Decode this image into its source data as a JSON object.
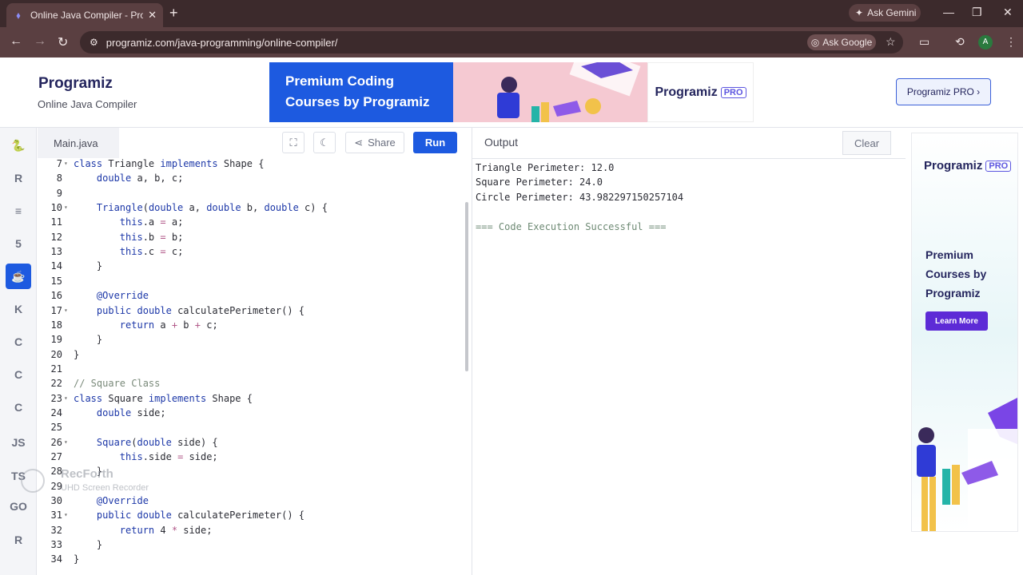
{
  "browser": {
    "tab_title": "Online Java Compiler - Program",
    "tab_close": "✕",
    "new_tab": "+",
    "ask_gemini": "Ask Gemini",
    "url": "programiz.com/java-programming/online-compiler/",
    "ask_google": "Ask Google",
    "avatar": "A"
  },
  "site": {
    "logo": "Programiz",
    "subtitle": "Online Java Compiler",
    "banner_text": "Premium Coding Courses by Programiz",
    "banner_logo": "Programiz",
    "pro_badge": "PRO",
    "pro_button": "Programiz PRO ›"
  },
  "rail": {
    "items": [
      {
        "name": "python",
        "glyph": "🐍",
        "active": false
      },
      {
        "name": "r",
        "glyph": "R",
        "active": false
      },
      {
        "name": "sql",
        "glyph": "≡",
        "active": false
      },
      {
        "name": "html",
        "glyph": "5",
        "active": false
      },
      {
        "name": "java",
        "glyph": "☕",
        "active": true
      },
      {
        "name": "kotlin",
        "glyph": "K",
        "active": false
      },
      {
        "name": "c",
        "glyph": "C",
        "active": false
      },
      {
        "name": "cpp",
        "glyph": "C",
        "active": false
      },
      {
        "name": "csharp",
        "glyph": "C",
        "active": false
      },
      {
        "name": "javascript",
        "glyph": "JS",
        "active": false
      },
      {
        "name": "typescript",
        "glyph": "TS",
        "active": false
      },
      {
        "name": "go",
        "glyph": "GO",
        "active": false
      },
      {
        "name": "rust",
        "glyph": "R",
        "active": false
      }
    ]
  },
  "editor": {
    "file_tab": "Main.java",
    "share_label": "Share",
    "run_label": "Run",
    "lines": [
      {
        "n": "7",
        "fold": true,
        "tokens": [
          [
            "kw",
            "class"
          ],
          [
            "ct",
            " Triangle "
          ],
          [
            "kw",
            "implements"
          ],
          [
            "ct",
            " Shape {"
          ]
        ]
      },
      {
        "n": "8",
        "fold": false,
        "tokens": [
          [
            "ct",
            "    "
          ],
          [
            "kw",
            "double"
          ],
          [
            "ct",
            " a, b, c;"
          ]
        ]
      },
      {
        "n": "9",
        "fold": false,
        "tokens": []
      },
      {
        "n": "10",
        "fold": true,
        "tokens": [
          [
            "ct",
            "    "
          ],
          [
            "kw",
            "Triangle"
          ],
          [
            "ct",
            "("
          ],
          [
            "kw",
            "double"
          ],
          [
            "ct",
            " a, "
          ],
          [
            "kw",
            "double"
          ],
          [
            "ct",
            " b, "
          ],
          [
            "kw",
            "double"
          ],
          [
            "ct",
            " c) {"
          ]
        ]
      },
      {
        "n": "11",
        "fold": false,
        "tokens": [
          [
            "ct",
            "        "
          ],
          [
            "kw",
            "this"
          ],
          [
            "ct",
            ".a "
          ],
          [
            "op",
            "="
          ],
          [
            "ct",
            " a;"
          ]
        ]
      },
      {
        "n": "12",
        "fold": false,
        "tokens": [
          [
            "ct",
            "        "
          ],
          [
            "kw",
            "this"
          ],
          [
            "ct",
            ".b "
          ],
          [
            "op",
            "="
          ],
          [
            "ct",
            " b;"
          ]
        ]
      },
      {
        "n": "13",
        "fold": false,
        "tokens": [
          [
            "ct",
            "        "
          ],
          [
            "kw",
            "this"
          ],
          [
            "ct",
            ".c "
          ],
          [
            "op",
            "="
          ],
          [
            "ct",
            " c;"
          ]
        ]
      },
      {
        "n": "14",
        "fold": false,
        "tokens": [
          [
            "ct",
            "    }"
          ]
        ]
      },
      {
        "n": "15",
        "fold": false,
        "tokens": []
      },
      {
        "n": "16",
        "fold": false,
        "tokens": [
          [
            "ct",
            "    "
          ],
          [
            "an",
            "@Override"
          ]
        ]
      },
      {
        "n": "17",
        "fold": true,
        "tokens": [
          [
            "ct",
            "    "
          ],
          [
            "kw",
            "public"
          ],
          [
            "ct",
            " "
          ],
          [
            "kw",
            "double"
          ],
          [
            "ct",
            " calculatePerimeter() {"
          ]
        ]
      },
      {
        "n": "18",
        "fold": false,
        "tokens": [
          [
            "ct",
            "        "
          ],
          [
            "kw",
            "return"
          ],
          [
            "ct",
            " a "
          ],
          [
            "op",
            "+"
          ],
          [
            "ct",
            " b "
          ],
          [
            "op",
            "+"
          ],
          [
            "ct",
            " c;"
          ]
        ]
      },
      {
        "n": "19",
        "fold": false,
        "tokens": [
          [
            "ct",
            "    }"
          ]
        ]
      },
      {
        "n": "20",
        "fold": false,
        "tokens": [
          [
            "ct",
            "}"
          ]
        ]
      },
      {
        "n": "21",
        "fold": false,
        "tokens": []
      },
      {
        "n": "22",
        "fold": false,
        "tokens": [
          [
            "cm",
            "// Square Class"
          ]
        ]
      },
      {
        "n": "23",
        "fold": true,
        "tokens": [
          [
            "kw",
            "class"
          ],
          [
            "ct",
            " Square "
          ],
          [
            "kw",
            "implements"
          ],
          [
            "ct",
            " Shape {"
          ]
        ]
      },
      {
        "n": "24",
        "fold": false,
        "tokens": [
          [
            "ct",
            "    "
          ],
          [
            "kw",
            "double"
          ],
          [
            "ct",
            " side;"
          ]
        ]
      },
      {
        "n": "25",
        "fold": false,
        "tokens": []
      },
      {
        "n": "26",
        "fold": true,
        "tokens": [
          [
            "ct",
            "    "
          ],
          [
            "kw",
            "Square"
          ],
          [
            "ct",
            "("
          ],
          [
            "kw",
            "double"
          ],
          [
            "ct",
            " side) {"
          ]
        ]
      },
      {
        "n": "27",
        "fold": false,
        "tokens": [
          [
            "ct",
            "        "
          ],
          [
            "kw",
            "this"
          ],
          [
            "ct",
            ".side "
          ],
          [
            "op",
            "="
          ],
          [
            "ct",
            " side;"
          ]
        ]
      },
      {
        "n": "28",
        "fold": false,
        "tokens": [
          [
            "ct",
            "    }"
          ]
        ]
      },
      {
        "n": "29",
        "fold": false,
        "tokens": []
      },
      {
        "n": "30",
        "fold": false,
        "tokens": [
          [
            "ct",
            "    "
          ],
          [
            "an",
            "@Override"
          ]
        ]
      },
      {
        "n": "31",
        "fold": true,
        "tokens": [
          [
            "ct",
            "    "
          ],
          [
            "kw",
            "public"
          ],
          [
            "ct",
            " "
          ],
          [
            "kw",
            "double"
          ],
          [
            "ct",
            " calculatePerimeter() {"
          ]
        ]
      },
      {
        "n": "32",
        "fold": false,
        "tokens": [
          [
            "ct",
            "        "
          ],
          [
            "kw",
            "return"
          ],
          [
            "ct",
            " 4 "
          ],
          [
            "op",
            "*"
          ],
          [
            "ct",
            " side;"
          ]
        ]
      },
      {
        "n": "33",
        "fold": false,
        "tokens": [
          [
            "ct",
            "    }"
          ]
        ]
      },
      {
        "n": "34",
        "fold": false,
        "tokens": [
          [
            "ct",
            "}"
          ]
        ]
      }
    ]
  },
  "output": {
    "title": "Output",
    "clear_label": "Clear",
    "lines": [
      {
        "text": "Triangle Perimeter: 12.0",
        "ok": false
      },
      {
        "text": "Square Perimeter: 24.0",
        "ok": false
      },
      {
        "text": "Circle Perimeter: 43.982297150257104",
        "ok": false
      },
      {
        "text": "",
        "ok": false
      },
      {
        "text": "=== Code Execution Successful ===",
        "ok": true
      }
    ]
  },
  "side_ad": {
    "logo": "Programiz",
    "badge": "PRO",
    "text": "Premium Courses by Programiz",
    "button": "Learn More"
  },
  "watermark": {
    "title": "RecForth",
    "subtitle": "UHD Screen Recorder"
  }
}
